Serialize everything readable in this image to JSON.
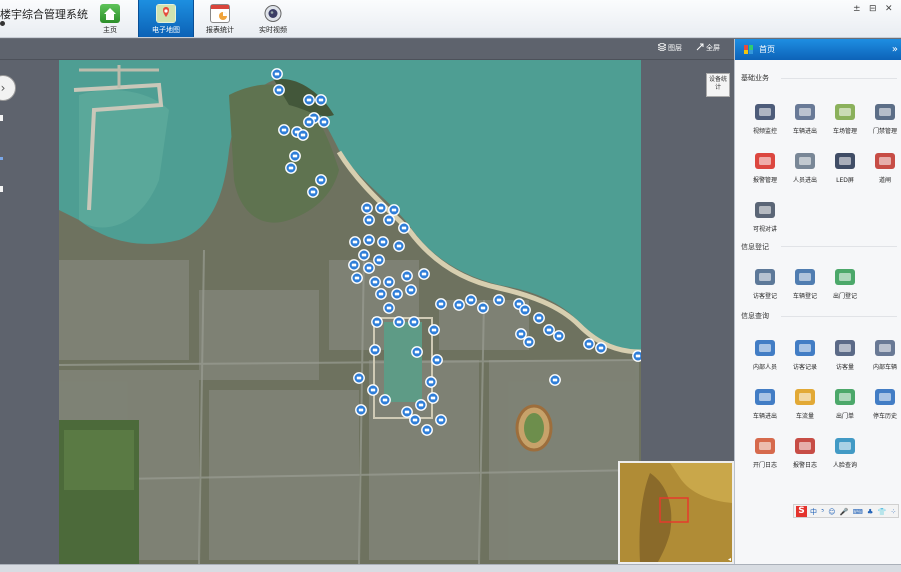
{
  "app": {
    "title": "楼宇综合管理系统",
    "nav": [
      {
        "label": "主页",
        "icon": "home-icon"
      },
      {
        "label": "电子地图",
        "icon": "map-icon"
      },
      {
        "label": "报表统计",
        "icon": "calendar-icon"
      },
      {
        "label": "实时视频",
        "icon": "camera-icon"
      }
    ],
    "window_controls": [
      "±",
      "⊟",
      "✕"
    ]
  },
  "map_toolbar": {
    "layers_label": "图层",
    "fullscreen_label": "全屏"
  },
  "map": {
    "device_stats_label": "设备统计",
    "compass_glyph": "›"
  },
  "panel": {
    "title": "首页",
    "collapse_glyph": "»",
    "sections": [
      {
        "title": "基础业务",
        "items": [
          {
            "label": "视频监控",
            "icon": "surveillance-camera-icon"
          },
          {
            "label": "车辆进出",
            "icon": "car-icon"
          },
          {
            "label": "车场管理",
            "icon": "parking-map-icon"
          },
          {
            "label": "门禁管理",
            "icon": "access-panel-icon"
          },
          {
            "label": "报警管理",
            "icon": "alarm-siren-icon"
          },
          {
            "label": "人员进出",
            "icon": "pedestrian-icon"
          },
          {
            "label": "LED屏",
            "icon": "led-screen-icon"
          },
          {
            "label": "道闸",
            "icon": "barrier-gate-icon"
          },
          {
            "label": "可视对讲",
            "icon": "video-intercom-icon"
          }
        ]
      },
      {
        "title": "信息登记",
        "items": [
          {
            "label": "访客登记",
            "icon": "visitor-register-icon"
          },
          {
            "label": "车辆登记",
            "icon": "vehicle-register-icon"
          },
          {
            "label": "出门登记",
            "icon": "exit-register-icon"
          }
        ]
      },
      {
        "title": "信息查询",
        "items": [
          {
            "label": "内部人员",
            "icon": "staff-icon"
          },
          {
            "label": "访客记录",
            "icon": "visitor-log-chart-icon"
          },
          {
            "label": "访客量",
            "icon": "visitor-count-icon"
          },
          {
            "label": "内部车辆",
            "icon": "internal-vehicle-icon"
          },
          {
            "label": "车辆进出",
            "icon": "vehicle-flow-icon"
          },
          {
            "label": "车流量",
            "icon": "traffic-bar-chart-icon"
          },
          {
            "label": "出门单",
            "icon": "exit-slip-icon"
          },
          {
            "label": "停车历史",
            "icon": "parking-history-icon"
          },
          {
            "label": "开门日志",
            "icon": "door-log-icon"
          },
          {
            "label": "报警日志",
            "icon": "alarm-log-icon"
          },
          {
            "label": "人脸查询",
            "icon": "face-search-icon"
          }
        ]
      }
    ]
  },
  "ime": {
    "logo": "S",
    "text": "中 ⁵ ☺ 🎤 ⌨ ♣ 👕 ⁘"
  },
  "colors": {
    "accent": "#1478cf",
    "marker": "#2f7ed8",
    "sea": "#4d9f95",
    "toolbar": "#5e636d"
  }
}
